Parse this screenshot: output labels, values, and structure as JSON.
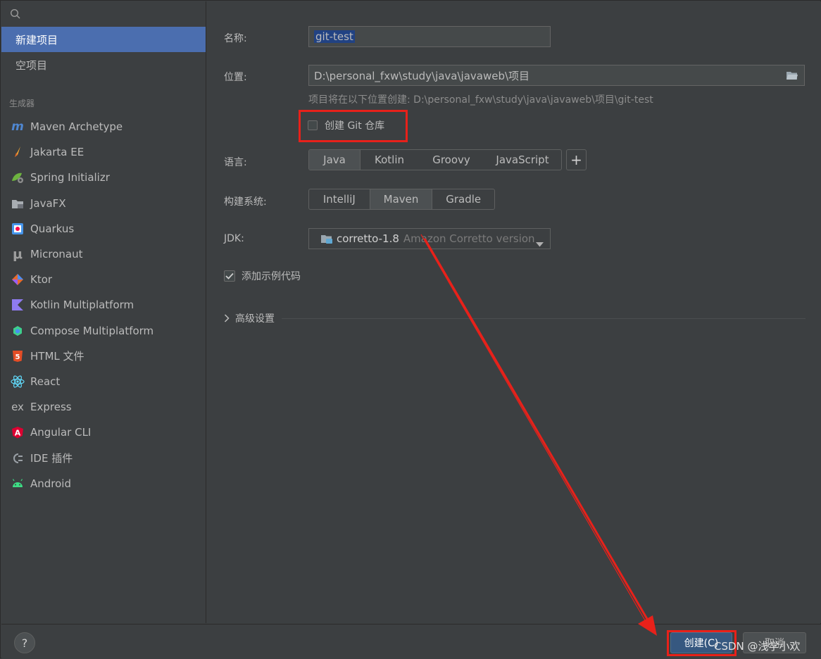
{
  "search": {
    "icon": "search-icon"
  },
  "project_types": [
    {
      "label": "新建项目",
      "selected": true
    },
    {
      "label": "空项目",
      "selected": false
    }
  ],
  "generators_title": "生成器",
  "generators": [
    {
      "label": "Maven Archetype",
      "icon": "maven-icon"
    },
    {
      "label": "Jakarta EE",
      "icon": "jakarta-icon"
    },
    {
      "label": "Spring Initializr",
      "icon": "spring-icon"
    },
    {
      "label": "JavaFX",
      "icon": "javafx-icon"
    },
    {
      "label": "Quarkus",
      "icon": "quarkus-icon"
    },
    {
      "label": "Micronaut",
      "icon": "micronaut-icon"
    },
    {
      "label": "Ktor",
      "icon": "ktor-icon"
    },
    {
      "label": "Kotlin Multiplatform",
      "icon": "kotlin-icon"
    },
    {
      "label": "Compose Multiplatform",
      "icon": "compose-icon"
    },
    {
      "label": "HTML 文件",
      "icon": "html5-icon"
    },
    {
      "label": "React",
      "icon": "react-icon"
    },
    {
      "label": "Express",
      "icon": "express-icon"
    },
    {
      "label": "Angular CLI",
      "icon": "angular-icon"
    },
    {
      "label": "IDE 插件",
      "icon": "plugin-icon"
    },
    {
      "label": "Android",
      "icon": "android-icon"
    }
  ],
  "form": {
    "name_label": "名称:",
    "name_value": "git-test",
    "location_label": "位置:",
    "location_value": "D:\\personal_fxw\\study\\java\\javaweb\\项目",
    "location_hint": "项目将在以下位置创建: D:\\personal_fxw\\study\\java\\javaweb\\项目\\git-test",
    "git_label": "创建 Git 仓库",
    "git_checked": false,
    "language_label": "语言:",
    "languages": [
      "Java",
      "Kotlin",
      "Groovy",
      "JavaScript"
    ],
    "language_selected": "Java",
    "add_label": "+",
    "build_label": "构建系统:",
    "build_systems": [
      "IntelliJ",
      "Maven",
      "Gradle"
    ],
    "build_selected": "Maven",
    "jdk_label": "JDK:",
    "jdk_value": "corretto-1.8",
    "jdk_detail": "Amazon Corretto version",
    "sample_label": "添加示例代码",
    "sample_checked": true,
    "advanced_label": "高级设置"
  },
  "footer": {
    "help_label": "?",
    "create_label": "创建(C)",
    "cancel_label": "取消"
  },
  "watermark": "CSDN @浅学小欢",
  "colors": {
    "accent": "#4b6eaf",
    "annotation": "#e8211a",
    "background": "#3c3f41"
  }
}
